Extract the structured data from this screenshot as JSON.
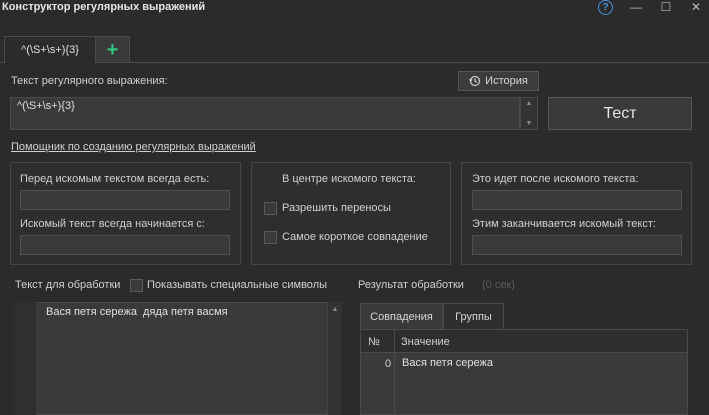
{
  "window": {
    "title": "Конструктор регулярных выражений",
    "help_glyph": "?",
    "minimize_glyph": "—",
    "maximize_glyph": "☐",
    "close_glyph": "✕"
  },
  "tabs": [
    {
      "label": "^(\\S+\\s+){3}"
    },
    {
      "label": "+"
    }
  ],
  "regex": {
    "label": "Текст регулярного выражения:",
    "history_label": "История",
    "value": "^(\\S+\\s+){3}",
    "test_label": "Тест"
  },
  "helper_link": "Помощник по созданию регулярных выражений",
  "before_panel": {
    "always_before_label": "Перед искомым текстом всегда есть:",
    "starts_with_label": "Искомый текст всегда начинается с:"
  },
  "center_panel": {
    "title": "В центре искомого текста:",
    "allow_wrap_label": "Разрешить переносы",
    "shortest_match_label": "Самое короткое совпадение"
  },
  "after_panel": {
    "after_label": "Это идет после искомого текста:",
    "ends_with_label": "Этим заканчивается искомый текст:"
  },
  "input_text": {
    "label": "Текст для обработки",
    "show_special_label": "Показывать специальные символы",
    "content": "Вася петя сережа  дяда петя васмя"
  },
  "result": {
    "label": "Результат обработки",
    "time": "(0 сек)",
    "tabs": [
      "Совпадения",
      "Группы"
    ],
    "columns": [
      "№",
      "Значение"
    ],
    "rows": [
      {
        "num": "0",
        "value": "Вася петя сережа"
      }
    ]
  },
  "colors": {
    "background": "#2b2b2b",
    "accent_plus": "#33c481",
    "help_blue": "#4a90e2"
  }
}
